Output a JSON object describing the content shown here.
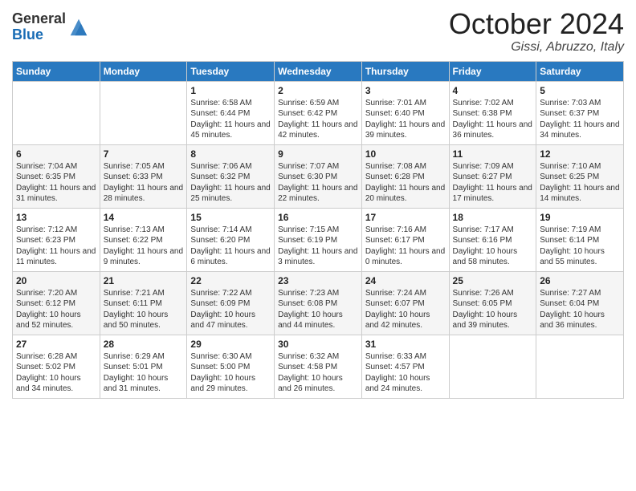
{
  "header": {
    "logo_general": "General",
    "logo_blue": "Blue",
    "month": "October 2024",
    "location": "Gissi, Abruzzo, Italy"
  },
  "days_of_week": [
    "Sunday",
    "Monday",
    "Tuesday",
    "Wednesday",
    "Thursday",
    "Friday",
    "Saturday"
  ],
  "weeks": [
    [
      {
        "day": "",
        "info": ""
      },
      {
        "day": "",
        "info": ""
      },
      {
        "day": "1",
        "info": "Sunrise: 6:58 AM\nSunset: 6:44 PM\nDaylight: 11 hours and 45 minutes."
      },
      {
        "day": "2",
        "info": "Sunrise: 6:59 AM\nSunset: 6:42 PM\nDaylight: 11 hours and 42 minutes."
      },
      {
        "day": "3",
        "info": "Sunrise: 7:01 AM\nSunset: 6:40 PM\nDaylight: 11 hours and 39 minutes."
      },
      {
        "day": "4",
        "info": "Sunrise: 7:02 AM\nSunset: 6:38 PM\nDaylight: 11 hours and 36 minutes."
      },
      {
        "day": "5",
        "info": "Sunrise: 7:03 AM\nSunset: 6:37 PM\nDaylight: 11 hours and 34 minutes."
      }
    ],
    [
      {
        "day": "6",
        "info": "Sunrise: 7:04 AM\nSunset: 6:35 PM\nDaylight: 11 hours and 31 minutes."
      },
      {
        "day": "7",
        "info": "Sunrise: 7:05 AM\nSunset: 6:33 PM\nDaylight: 11 hours and 28 minutes."
      },
      {
        "day": "8",
        "info": "Sunrise: 7:06 AM\nSunset: 6:32 PM\nDaylight: 11 hours and 25 minutes."
      },
      {
        "day": "9",
        "info": "Sunrise: 7:07 AM\nSunset: 6:30 PM\nDaylight: 11 hours and 22 minutes."
      },
      {
        "day": "10",
        "info": "Sunrise: 7:08 AM\nSunset: 6:28 PM\nDaylight: 11 hours and 20 minutes."
      },
      {
        "day": "11",
        "info": "Sunrise: 7:09 AM\nSunset: 6:27 PM\nDaylight: 11 hours and 17 minutes."
      },
      {
        "day": "12",
        "info": "Sunrise: 7:10 AM\nSunset: 6:25 PM\nDaylight: 11 hours and 14 minutes."
      }
    ],
    [
      {
        "day": "13",
        "info": "Sunrise: 7:12 AM\nSunset: 6:23 PM\nDaylight: 11 hours and 11 minutes."
      },
      {
        "day": "14",
        "info": "Sunrise: 7:13 AM\nSunset: 6:22 PM\nDaylight: 11 hours and 9 minutes."
      },
      {
        "day": "15",
        "info": "Sunrise: 7:14 AM\nSunset: 6:20 PM\nDaylight: 11 hours and 6 minutes."
      },
      {
        "day": "16",
        "info": "Sunrise: 7:15 AM\nSunset: 6:19 PM\nDaylight: 11 hours and 3 minutes."
      },
      {
        "day": "17",
        "info": "Sunrise: 7:16 AM\nSunset: 6:17 PM\nDaylight: 11 hours and 0 minutes."
      },
      {
        "day": "18",
        "info": "Sunrise: 7:17 AM\nSunset: 6:16 PM\nDaylight: 10 hours and 58 minutes."
      },
      {
        "day": "19",
        "info": "Sunrise: 7:19 AM\nSunset: 6:14 PM\nDaylight: 10 hours and 55 minutes."
      }
    ],
    [
      {
        "day": "20",
        "info": "Sunrise: 7:20 AM\nSunset: 6:12 PM\nDaylight: 10 hours and 52 minutes."
      },
      {
        "day": "21",
        "info": "Sunrise: 7:21 AM\nSunset: 6:11 PM\nDaylight: 10 hours and 50 minutes."
      },
      {
        "day": "22",
        "info": "Sunrise: 7:22 AM\nSunset: 6:09 PM\nDaylight: 10 hours and 47 minutes."
      },
      {
        "day": "23",
        "info": "Sunrise: 7:23 AM\nSunset: 6:08 PM\nDaylight: 10 hours and 44 minutes."
      },
      {
        "day": "24",
        "info": "Sunrise: 7:24 AM\nSunset: 6:07 PM\nDaylight: 10 hours and 42 minutes."
      },
      {
        "day": "25",
        "info": "Sunrise: 7:26 AM\nSunset: 6:05 PM\nDaylight: 10 hours and 39 minutes."
      },
      {
        "day": "26",
        "info": "Sunrise: 7:27 AM\nSunset: 6:04 PM\nDaylight: 10 hours and 36 minutes."
      }
    ],
    [
      {
        "day": "27",
        "info": "Sunrise: 6:28 AM\nSunset: 5:02 PM\nDaylight: 10 hours and 34 minutes."
      },
      {
        "day": "28",
        "info": "Sunrise: 6:29 AM\nSunset: 5:01 PM\nDaylight: 10 hours and 31 minutes."
      },
      {
        "day": "29",
        "info": "Sunrise: 6:30 AM\nSunset: 5:00 PM\nDaylight: 10 hours and 29 minutes."
      },
      {
        "day": "30",
        "info": "Sunrise: 6:32 AM\nSunset: 4:58 PM\nDaylight: 10 hours and 26 minutes."
      },
      {
        "day": "31",
        "info": "Sunrise: 6:33 AM\nSunset: 4:57 PM\nDaylight: 10 hours and 24 minutes."
      },
      {
        "day": "",
        "info": ""
      },
      {
        "day": "",
        "info": ""
      }
    ]
  ]
}
